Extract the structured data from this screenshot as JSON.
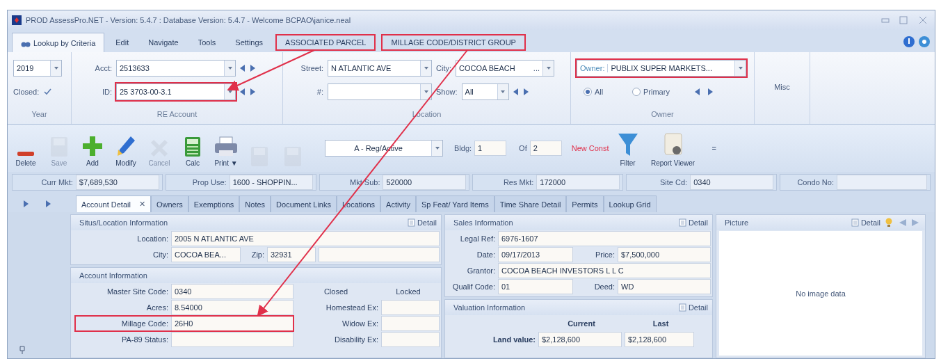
{
  "window": {
    "title": "PROD AssessPro.NET - Version: 5.4.7 : Database Version: 5.4.7 - Welcome BCPAO\\janice.neal"
  },
  "menu_tabs": [
    {
      "label": "Lookup by Criteria",
      "selected": true,
      "highlighted": false
    },
    {
      "label": "Edit",
      "selected": false,
      "highlighted": false
    },
    {
      "label": "Navigate",
      "selected": false,
      "highlighted": false
    },
    {
      "label": "Tools",
      "selected": false,
      "highlighted": false
    },
    {
      "label": "Settings",
      "selected": false,
      "highlighted": false
    },
    {
      "label": "ASSOCIATED PARCEL",
      "selected": false,
      "highlighted": true
    },
    {
      "label": "MILLAGE CODE/DISTRICT GROUP",
      "selected": false,
      "highlighted": true
    }
  ],
  "ribbon": {
    "year": {
      "value": "2019",
      "closed_label": "Closed:",
      "closed_checked": true,
      "group": "Year"
    },
    "re_account": {
      "acct_label": "Acct:",
      "acct": "2513633",
      "id_label": "ID:",
      "id": "25 3703-00-3.1",
      "id_highlighted": true,
      "group": "RE Account"
    },
    "location": {
      "street_label": "Street:",
      "street": "N ATLANTIC AVE",
      "city_label": "City:",
      "city": "COCOA BEACH",
      "city_more": "...",
      "number_label": "#:",
      "show_label": "Show:",
      "show": "All",
      "group": "Location"
    },
    "owner": {
      "owner_label": "Owner:",
      "owner": "PUBLIX SUPER MARKETS...",
      "highlighted": true,
      "options": [
        {
          "label": "All",
          "selected": true
        },
        {
          "label": "Primary",
          "selected": false
        }
      ],
      "group": "Owner"
    },
    "misc": "Misc"
  },
  "toolbar": [
    {
      "kind": "delete",
      "label": "Delete",
      "disabled": false
    },
    {
      "kind": "save",
      "label": "Save",
      "disabled": true
    },
    {
      "kind": "add",
      "label": "Add",
      "disabled": false
    },
    {
      "kind": "modify",
      "label": "Modify",
      "disabled": false
    },
    {
      "kind": "cancel",
      "label": "Cancel",
      "disabled": true
    },
    {
      "kind": "calc",
      "label": "Calc",
      "disabled": false
    },
    {
      "kind": "print",
      "label": "Print ▼",
      "disabled": false
    },
    {
      "kind": "save",
      "disabled": true
    },
    {
      "kind": "save",
      "disabled": true
    }
  ],
  "status": {
    "value": "A - Reg/Active",
    "bldg_label": "Bldg:",
    "bldg": "1",
    "of_label": "Of",
    "of": "2",
    "new_const": "New Const"
  },
  "tools_right": [
    {
      "kind": "filter",
      "label": "Filter"
    },
    {
      "kind": "report",
      "label": "Report Viewer"
    }
  ],
  "more": "=",
  "info_bar": [
    {
      "label": "Curr Mkt:",
      "value": "$7,689,530"
    },
    {
      "label": "Prop Use:",
      "value": "1600 - SHOPPIN..."
    },
    {
      "label": "Mkt Sub:",
      "value": "520000"
    },
    {
      "label": "Res Mkt:",
      "value": "172000"
    },
    {
      "label": "Site Cd:",
      "value": "0340"
    },
    {
      "label": "Condo No:"
    }
  ],
  "detail_tabs": [
    {
      "label": "Account Detail",
      "selected": true,
      "closable": true,
      "close": "✕"
    },
    {
      "label": "Owners",
      "selected": false
    },
    {
      "label": "Exemptions",
      "selected": false
    },
    {
      "label": "Notes",
      "selected": false
    },
    {
      "label": "Document Links",
      "selected": false
    },
    {
      "label": "Locations",
      "selected": false
    },
    {
      "label": "Activity",
      "selected": false
    },
    {
      "label": "Sp Feat/ Yard Items",
      "selected": false
    },
    {
      "label": "Time Share Detail",
      "selected": false
    },
    {
      "label": "Permits",
      "selected": false
    },
    {
      "label": "Lookup Grid",
      "selected": false
    }
  ],
  "situs": {
    "title": "Situs/Location Information",
    "detail": "Detail",
    "location_label": "Location:",
    "location": "2005 N ATLANTIC AVE",
    "city_label": "City:",
    "city": "COCOA BEA...",
    "zip_label": "Zip:",
    "zip": "32931"
  },
  "account": {
    "title": "Account Information",
    "fields": [
      {
        "label": "Master Site Code:",
        "value": "0340",
        "highlighted": false
      },
      {
        "label": "Acres:",
        "value": "8.54000",
        "highlighted": false
      },
      {
        "label": "Millage Code:",
        "value": "26H0",
        "highlighted": true
      },
      {
        "label": "PA-89 Status:",
        "highlighted": false
      }
    ],
    "headers": [
      "Closed",
      "Locked"
    ],
    "exemptions": [
      "Homestead Ex:",
      "Widow Ex:",
      "Disability Ex:"
    ]
  },
  "sales": {
    "title": "Sales Information",
    "detail": "Detail",
    "legal_label": "Legal Ref:",
    "legal": "6976-1607",
    "date_label": "Date:",
    "date": "09/17/2013",
    "price_label": "Price:",
    "price": "$7,500,000",
    "grantor_label": "Grantor:",
    "grantor": "COCOA BEACH INVESTORS L L C",
    "qualif_label": "Qualif Code:",
    "qualif": "01",
    "deed_label": "Deed:",
    "deed": "WD"
  },
  "valuation": {
    "title": "Valuation Information",
    "detail": "Detail",
    "columns": [
      "Current",
      "Last"
    ],
    "rows": [
      {
        "label": "Land value:",
        "current": "$2,128,600",
        "last": "$2,128,600"
      }
    ]
  },
  "picture": {
    "title": "Picture",
    "detail": "Detail",
    "empty": "No image data"
  }
}
